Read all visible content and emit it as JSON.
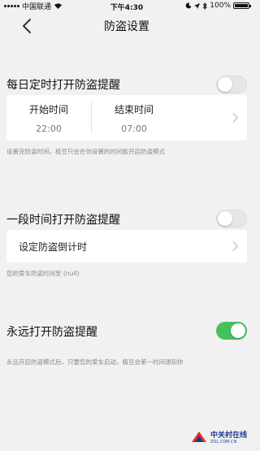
{
  "status_bar": {
    "carrier": "中国联通",
    "time": "下午4:30",
    "battery": "100%",
    "battery_level": 1.0
  },
  "nav": {
    "title": "防盗设置",
    "back_icon": "chevron-left-icon"
  },
  "daily": {
    "title": "每日定时打开防盗提醒",
    "enabled": false,
    "start_label": "开始时间",
    "start_value": "22:00",
    "end_label": "结束时间",
    "end_value": "07:00",
    "hint": "设置完防盗时间，极豆只会在你设置的时间能开启防盗模式"
  },
  "period": {
    "title": "一段时间打开防盗提醒",
    "enabled": false,
    "countdown_label": "设定防盗倒计时",
    "hint": "您的爱车防盗时间至 (null)"
  },
  "forever": {
    "title": "永远打开防盗提醒",
    "enabled": true,
    "hint": "永远开启防盗模式后，只要您的爱车启动，极豆会第一时间通知你"
  },
  "watermark": {
    "cn": "中关村在线",
    "en": "ZOL.COM.CN"
  },
  "colors": {
    "toggle_on": "#45c15d",
    "background": "#f1f1f1"
  }
}
